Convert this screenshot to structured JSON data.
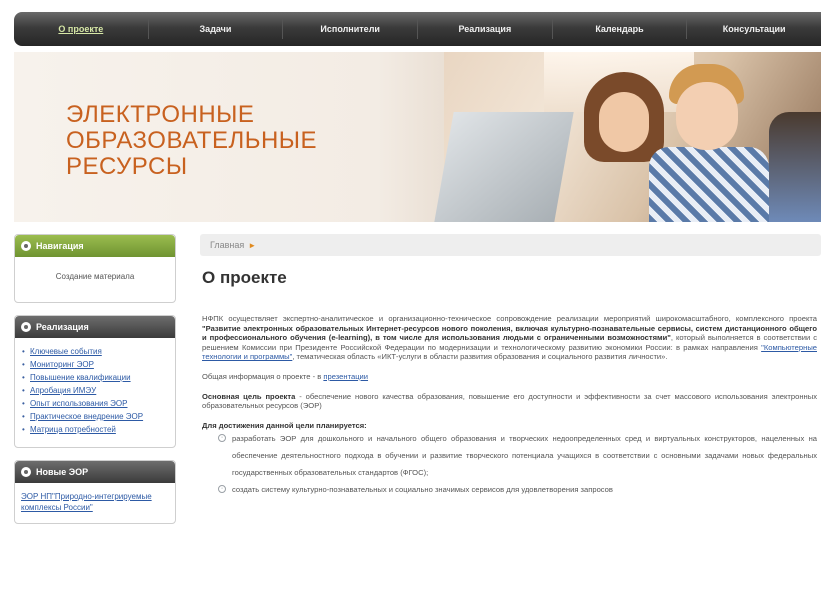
{
  "topnav": {
    "items": [
      "О проекте",
      "Задачи",
      "Исполнители",
      "Реализация",
      "Календарь",
      "Консультации"
    ]
  },
  "banner": {
    "title_line1": "ЭЛЕКТРОННЫЕ",
    "title_line2": "ОБРАЗОВАТЕЛЬНЫЕ",
    "title_line3": "РЕСУРСЫ"
  },
  "sidebar": {
    "navigation": {
      "title": "Навигация",
      "item": "Создание материала"
    },
    "realization": {
      "title": "Реализация",
      "items": [
        "Ключевые события",
        "Мониторинг ЭОР",
        "Повышение квалификации",
        "Апробация ИМЭУ",
        "Опыт использования ЭОР",
        "Практическое внедрение ЭОР",
        "Матрица потребностей"
      ]
    },
    "new_eor": {
      "title": "Новые ЭОР",
      "item": "ЭОР НП\"Природно-интегрируемые комплексы России\""
    }
  },
  "main": {
    "breadcrumb": "Главная",
    "title": "О проекте",
    "p1_start": "НФПК осуществляет экспертно-аналитическое и организационно-техническое сопровождение реализации мероприятий широкомасштабного, комплексного проекта ",
    "p1_bold": "\"Развитие электронных образовательных Интернет-ресурсов нового поколения, включая культурно-познавательные сервисы, систем дистанционного общего и профессионального обучения (e-learning), в том числе для использования людьми с ограниченными возможностями\"",
    "p1_mid": ", который выполняется в соответствии с решением Комиссии при Президенте Российской Федерации по модернизации и технологическому развитию экономики России: в рамках направления ",
    "p1_link": "\"Компьютерные технологии и программы\"",
    "p1_end": ", тематическая область «ИКТ-услуги в области развития образования и социального развития личности».",
    "p2_text": "Общая информация о проекте - в ",
    "p2_link": "презентации",
    "p3_bold": "Основная цель проекта",
    "p3_text": " - обеспечение нового качества образования, повышение его доступности и эффективности за счет массового использования электронных образовательных ресурсов (ЭОР)",
    "p4_bold": "Для достижения данной цели планируется:",
    "bullets": [
      "разработать ЭОР для дошкольного и начального общего образования и творческих недоопределенных сред и виртуальных конструкторов, нацеленных на обеспечение деятельностного подхода в обучении и развитие творческого потенциала учащихся в соответствии с основными задачами новых федеральных государственных образовательных стандартов (ФГОС);",
      "создать систему культурно-познавательных и социально значимых сервисов для удовлетворения запросов"
    ]
  }
}
